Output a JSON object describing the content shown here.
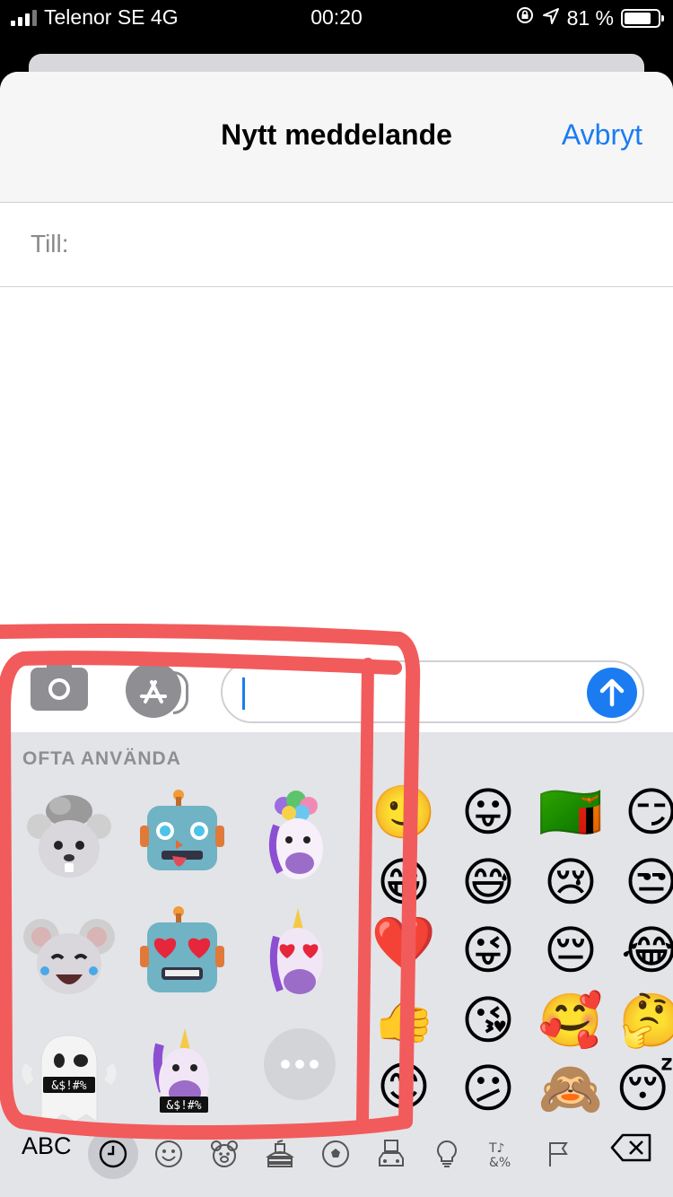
{
  "status_bar": {
    "carrier": "Telenor SE 4G",
    "time": "00:20",
    "battery": "81 %",
    "battery_level": 0.81
  },
  "navbar": {
    "title": "Nytt meddelande",
    "cancel_label": "Avbryt"
  },
  "recipient": {
    "label": "Till:"
  },
  "compose": {
    "camera_icon": "camera-icon",
    "appstore_icon": "appstore-icon",
    "send_icon": "arrow-up-icon",
    "accent": "#1b7cf2"
  },
  "keyboard": {
    "section_title": "OFTA ANVÄNDA",
    "memoji_stickers": [
      "mind-blown-mouse",
      "robot-tongue",
      "mind-blown-unicorn",
      "crying-laughing-mouse",
      "heart-eyes-robot",
      "heart-eyes-unicorn",
      "cursing-ghost",
      "cursing-unicorn"
    ],
    "censor_text": "&$!#%",
    "emoji_columns": [
      [
        "😛",
        "🇿🇲",
        "😏"
      ],
      [
        "😅",
        "😢",
        "😒"
      ],
      [
        "😜",
        "😔",
        "😂"
      ],
      [
        "😘",
        "🥰",
        "🤔"
      ],
      [
        "😕",
        "🙈",
        "😴"
      ]
    ],
    "abc_label": "ABC",
    "categories": [
      "clock-icon",
      "smiley-icon",
      "bear-icon",
      "food-icon",
      "ball-icon",
      "car-icon",
      "bulb-icon",
      "symbols-icon",
      "flag-icon"
    ],
    "delete_icon": "delete-icon"
  },
  "annotation_color": "#f25b5b"
}
